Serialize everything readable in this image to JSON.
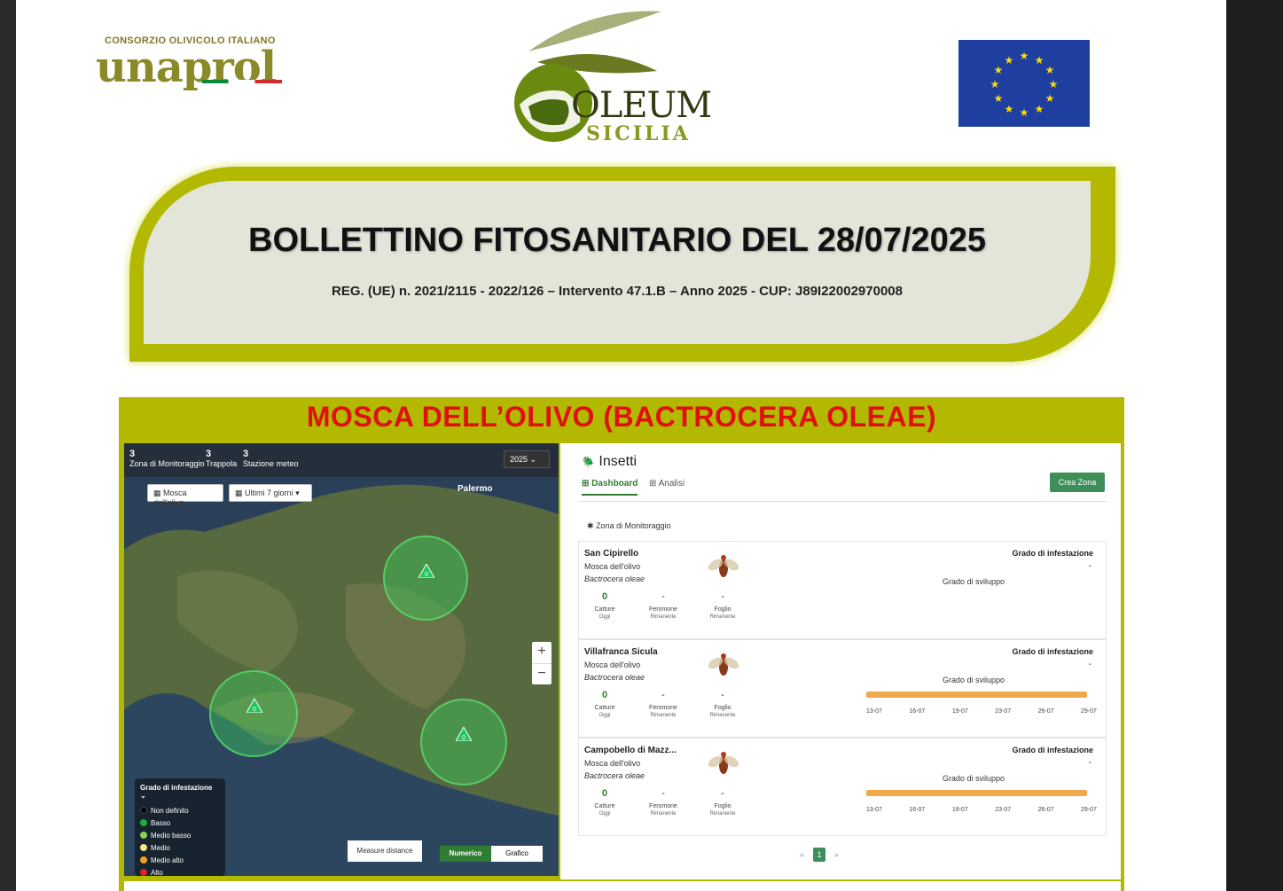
{
  "header": {
    "unaprol_sub": "CONSORZIO OLIVICOLO ITALIANO",
    "unaprol_name": "unaprol",
    "oleum_line1": "OLEUM",
    "oleum_line2": "SICILIA"
  },
  "title": {
    "main": "BOLLETTINO FITOSANITARIO DEL 28/07/2025",
    "sub": "REG. (UE) n. 2021/2115 - 2022/126 – Intervento 47.1.B – Anno 2025 - CUP: J89I22002970008"
  },
  "section": {
    "title": "MOSCA DELL’OLIVO (BACTROCERA OLEAE)"
  },
  "map": {
    "stats": [
      {
        "value": "3",
        "label": "Zona di Monitoraggio"
      },
      {
        "value": "3",
        "label": "Trappola"
      },
      {
        "value": "3",
        "label": "Stazione meteo"
      }
    ],
    "year": "2025",
    "filter_species": "Mosca dell'olivo",
    "filter_period": "Ultimi 7 giorni",
    "city": "Palermo",
    "zoom_in": "+",
    "zoom_out": "−",
    "legend_title": "Grado di infestazione",
    "legend": [
      {
        "label": "Non definito",
        "color": "#000000"
      },
      {
        "label": "Basso",
        "color": "#1faa3a"
      },
      {
        "label": "Medio basso",
        "color": "#8bd35a"
      },
      {
        "label": "Medio",
        "color": "#f2e88a"
      },
      {
        "label": "Medio alto",
        "color": "#f0a020"
      },
      {
        "label": "Alto",
        "color": "#e02020"
      }
    ],
    "measure": "Measure distance",
    "toggle_numeric": "Numerico",
    "toggle_chart": "Grafico",
    "marker_value": "0"
  },
  "dashboard": {
    "heading": "Insetti",
    "tab_dashboard": "Dashboard",
    "tab_analisi": "Analisi",
    "crea_zona": "Crea Zona",
    "zona_label": "Zona di Monitoraggio",
    "grado_label": "Grado di infestazione",
    "sviluppo_label": "Grado di sviluppo",
    "kpi_labels": {
      "catture": "Catture",
      "oggi": "Oggi",
      "feromone": "Feromone",
      "foglio": "Foglio",
      "rimanente": "Rimanente"
    },
    "cards": [
      {
        "name": "San Cipirello",
        "species": "Mosca dell'olivo",
        "latin": "Bactrocera oleae",
        "catture": "0",
        "feromone": "-",
        "foglio": "-",
        "grado": "-",
        "dates": []
      },
      {
        "name": "Villafranca Sicula",
        "species": "Mosca dell'olivo",
        "latin": "Bactrocera oleae",
        "catture": "0",
        "feromone": "-",
        "foglio": "-",
        "grado": "-",
        "dates": [
          "13-07",
          "16-07",
          "19-07",
          "23-07",
          "26-07",
          "29-07"
        ]
      },
      {
        "name": "Campobello di Mazz...",
        "species": "Mosca dell'olivo",
        "latin": "Bactrocera oleae",
        "catture": "0",
        "feromone": "-",
        "foglio": "-",
        "grado": "-",
        "dates": [
          "13-07",
          "16-07",
          "19-07",
          "23-07",
          "26-07",
          "29-07"
        ]
      }
    ],
    "pager": {
      "prev": "«",
      "page": "1",
      "next": "»"
    }
  },
  "colors": {
    "olive": "#b3b800",
    "title_red": "#e01010",
    "brand_green": "#3e8e5a",
    "bar_orange": "#f0a94a"
  }
}
